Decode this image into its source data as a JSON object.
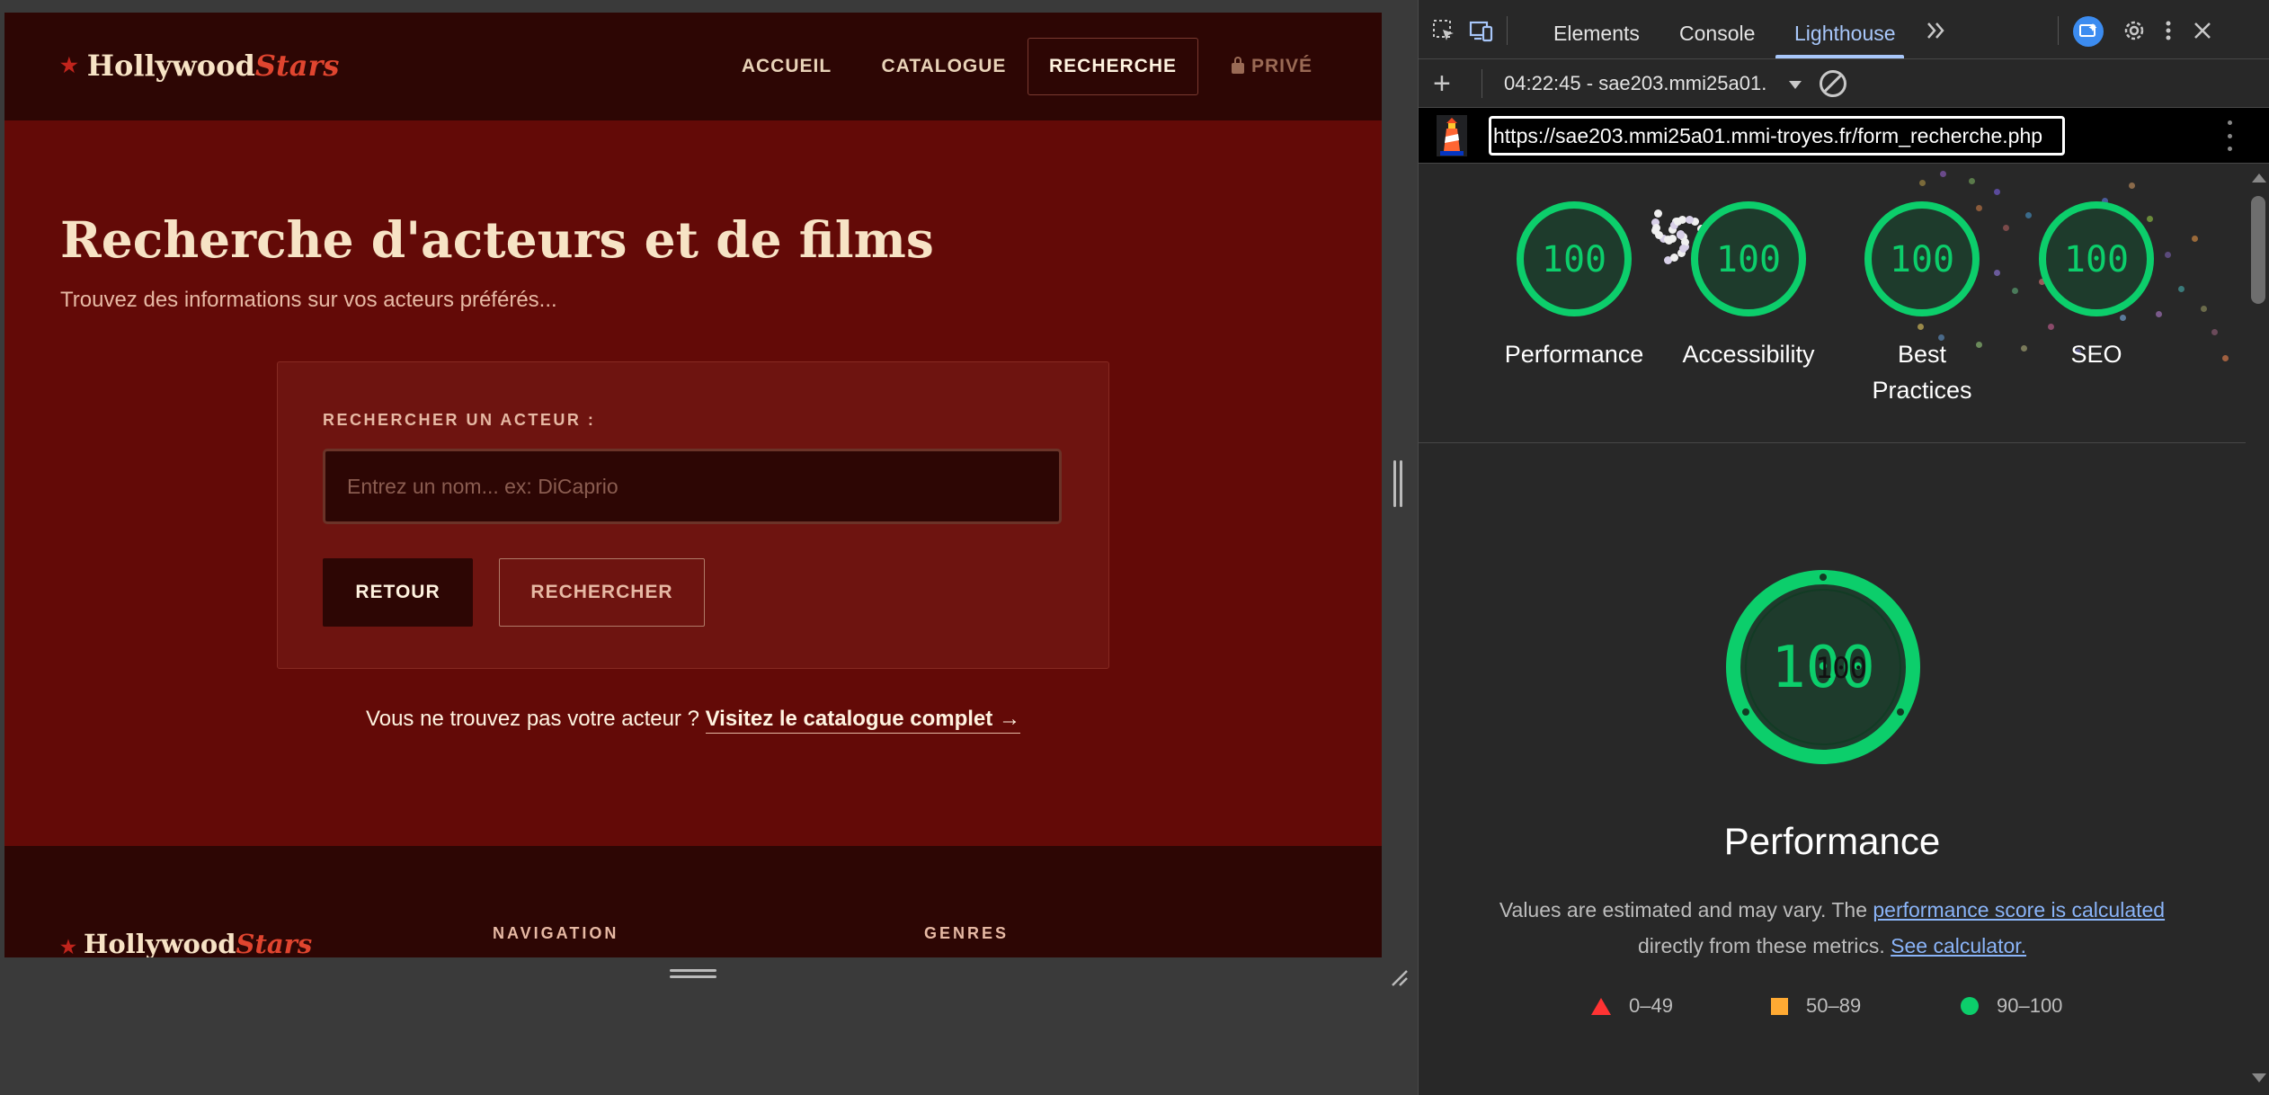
{
  "site": {
    "logo_main": "Hollywood",
    "logo_accent": "Stars",
    "nav": [
      "ACCUEIL",
      "CATALOGUE",
      "RECHERCHE",
      "PRIVÉ"
    ],
    "title": "Recherche d'acteurs et de films",
    "subtitle": "Trouvez des informations sur vos acteurs préférés...",
    "search": {
      "label": "RECHERCHER UN ACTEUR :",
      "placeholder": "Entrez un nom... ex: DiCaprio",
      "value": ""
    },
    "buttons": {
      "back": "RETOUR",
      "search": "RECHERCHER"
    },
    "hint": {
      "text": "Vous ne trouvez pas votre acteur ? ",
      "link": "Visitez le catalogue complet →"
    },
    "footer": {
      "logo_main": "Hollywood",
      "logo_accent": "Stars",
      "headings": [
        "NAVIGATION",
        "GENRES"
      ]
    }
  },
  "devtools": {
    "tabs": [
      "Elements",
      "Console",
      "Lighthouse"
    ],
    "active_tab": "Lighthouse",
    "report_selector": "04:22:45 - sae203.mmi25a01.",
    "url": "https://sae203.mmi25a01.mmi-troyes.fr/form_recherche.php",
    "scores": [
      {
        "label": "Performance",
        "score": "100"
      },
      {
        "label": "Accessibility",
        "score": "100"
      },
      {
        "label": "Best Practices",
        "score": "100"
      },
      {
        "label": "SEO",
        "score": "100"
      }
    ],
    "main_score": "100",
    "main_label": "Performance",
    "description_1": "Values are estimated and may vary. The ",
    "description_link_1": "performance score is calculated",
    "description_2": " directly from these metrics. ",
    "description_link_2": "See calculator.",
    "legend": [
      "0–49",
      "50–89",
      "90–100"
    ],
    "colors": {
      "pass": "#0cce6b",
      "average": "#ffaa33",
      "fail": "#ff3333",
      "accent": "#a8c7fa"
    }
  }
}
